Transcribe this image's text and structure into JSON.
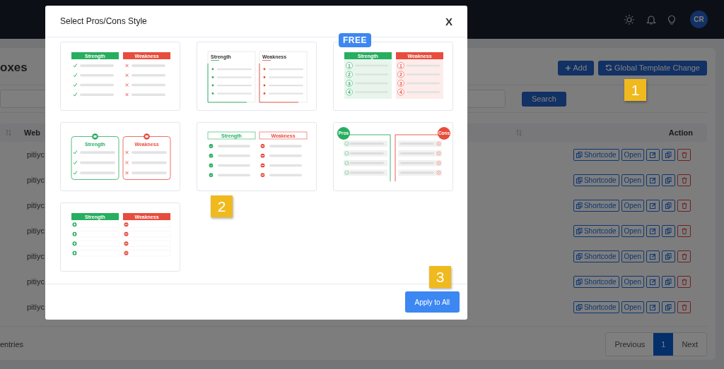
{
  "topbar": {
    "avatar": "CR"
  },
  "page": {
    "title": "oxes",
    "add_button": "Add",
    "global_button": "Global Template Change",
    "search_button": "Search",
    "table": {
      "columns": [
        "Web",
        "Action"
      ],
      "rows": [
        {
          "website": "pitiyc",
          "actions": [
            "Shortcode",
            "Open"
          ]
        },
        {
          "website": "pitiyc",
          "actions": [
            "Shortcode",
            "Open"
          ]
        },
        {
          "website": "pitiyc",
          "actions": [
            "Shortcode",
            "Open"
          ]
        },
        {
          "website": "pitiyc",
          "actions": [
            "Shortcode",
            "Open"
          ]
        },
        {
          "website": "pitiyc",
          "actions": [
            "Shortcode",
            "Open"
          ]
        },
        {
          "website": "pitiyc",
          "actions": [
            "Shortcode",
            "Open"
          ]
        },
        {
          "website": "pitiyc",
          "actions": [
            "Shortcode",
            "Open"
          ]
        }
      ]
    },
    "entries_text": "entries",
    "pagination": [
      {
        "label": "Previous",
        "selected": false
      },
      {
        "label": "1",
        "selected": true
      },
      {
        "label": "Next",
        "selected": false
      }
    ]
  },
  "modal": {
    "title": "Select Pros/Cons Style",
    "close": "X",
    "templates": [
      {
        "kind": "check-x",
        "pro_label": "Strength",
        "con_label": "Weakness"
      },
      {
        "kind": "bordered-dots",
        "pro_label": "Strength",
        "con_label": "Weakness"
      },
      {
        "kind": "numbered",
        "pro_label": "Strength",
        "con_label": "Weakness",
        "badge": "FREE",
        "pro_markers": [
          "1",
          "2",
          "3",
          "4"
        ],
        "con_markers": [
          "1",
          "2",
          "3",
          "4"
        ]
      },
      {
        "kind": "thumbs",
        "pro_label": "Strength",
        "con_label": "Weakness"
      },
      {
        "kind": "outline-circle",
        "pro_label": "Strength",
        "con_label": "Weakness"
      },
      {
        "kind": "pros-cons-line",
        "pro_label": "Pros",
        "con_label": "Cons"
      },
      {
        "kind": "plus-minus-table",
        "pro_label": "Strength",
        "con_label": "Weakness"
      }
    ],
    "apply_button": "Apply to All"
  },
  "callouts": [
    "1",
    "2",
    "3"
  ]
}
